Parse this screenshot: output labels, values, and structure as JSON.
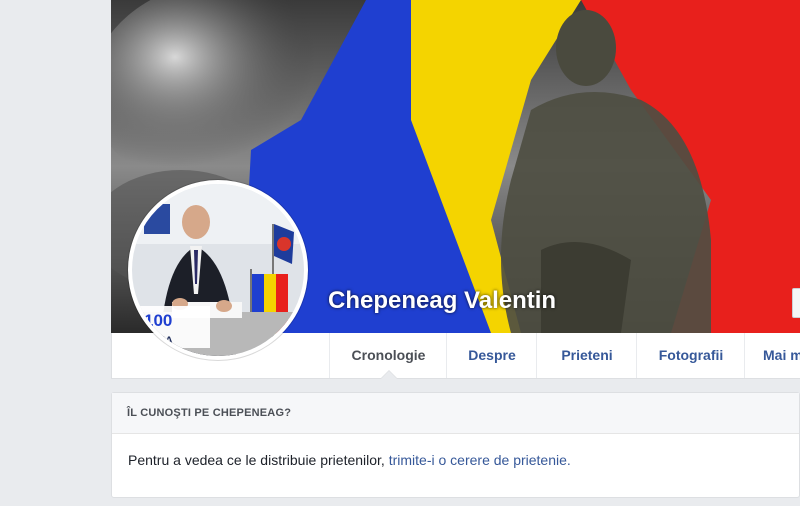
{
  "profile": {
    "name": "Chepeneag Valentin",
    "avatar_badge_number": "100",
    "avatar_badge_text": "ÂNIA"
  },
  "nav": {
    "tabs": [
      {
        "label": "Cronologie",
        "active": true
      },
      {
        "label": "Despre",
        "active": false
      },
      {
        "label": "Prieteni",
        "active": false
      },
      {
        "label": "Fotografii",
        "active": false
      },
      {
        "label": "Mai m",
        "active": false
      }
    ]
  },
  "friend_card": {
    "header": "ÎL CUNOŞTI PE CHEPENEAG?",
    "body_text": "Pentru a vedea ce le distribuie prietenilor,",
    "link_text": "trimite-i o cerere de prietenie."
  },
  "colors": {
    "page_bg": "#e9ebee",
    "link": "#365899",
    "flag_blue": "#1f3fd0",
    "flag_yellow": "#f4d400",
    "flag_red": "#e8201c"
  }
}
